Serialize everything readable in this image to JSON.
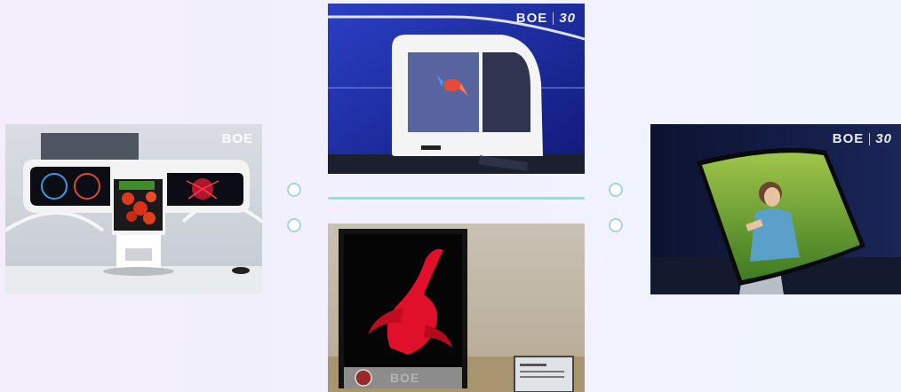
{
  "photos": {
    "cockpit": {
      "brand": "BOE"
    },
    "holo": {
      "brand": "BOE",
      "anniversary": "30"
    },
    "splash": {
      "brand": "BOE"
    },
    "curved": {
      "brand": "BOE",
      "anniversary": "30"
    }
  },
  "colors": {
    "accent": "#a7d6cf",
    "background": "#f2f0fd",
    "showroom_blue": "#1e2fa6"
  }
}
